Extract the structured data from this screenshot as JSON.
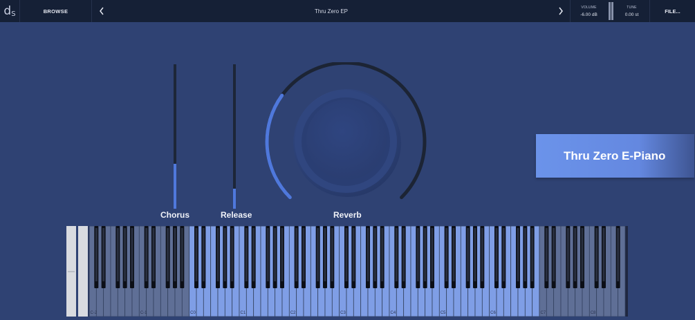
{
  "topbar": {
    "logo_main": "d",
    "logo_sub": "S",
    "browse_label": "BROWSE",
    "preset_name": "Thru Zero EP",
    "volume_caption": "VOLUME",
    "volume_value": "-6.00 dB",
    "tune_caption": "TUNE",
    "tune_value": "0.00 st",
    "file_label": "FILE...",
    "prev_icon": "chevron-left-icon",
    "next_icon": "chevron-right-icon"
  },
  "controls": {
    "chorus": {
      "label": "Chorus",
      "value": 0.31
    },
    "release": {
      "label": "Release",
      "value": 0.14
    },
    "reverb": {
      "label": "Reverb",
      "value": 0.3
    }
  },
  "patch_name": "Thru Zero E-Piano",
  "keyboard": {
    "octave_labels": [
      "C-2",
      "C-1",
      "C0",
      "C1",
      "C2",
      "C3",
      "C4",
      "C5",
      "C6",
      "C7",
      "C8"
    ],
    "playable_range": [
      "C0",
      "C7"
    ],
    "colors": {
      "inactive_white": "#5f6f96",
      "active_white": "#7f9ee6",
      "black_key": "#0c0f17",
      "key_border": "#33415f"
    }
  },
  "colors": {
    "background": "#2f4273",
    "topbar": "#152036",
    "accent": "#4f78dc",
    "track": "#1d2638"
  }
}
